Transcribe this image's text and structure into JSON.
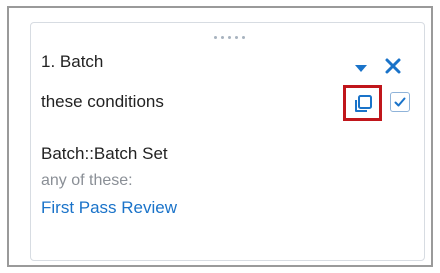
{
  "condition_card": {
    "title": "1. Batch",
    "conditions_label": "these conditions",
    "field_name": "Batch::Batch Set",
    "operator": "any of these:",
    "value": "First Pass Review"
  },
  "icons": {
    "drag": "drag-handle-icon",
    "expand": "caret-down-icon",
    "remove": "close-icon",
    "copy": "copy-icon",
    "check": "check-icon"
  },
  "colors": {
    "accent": "#1a73c9",
    "highlight": "#c0161b",
    "muted_text": "#8a8f96"
  }
}
